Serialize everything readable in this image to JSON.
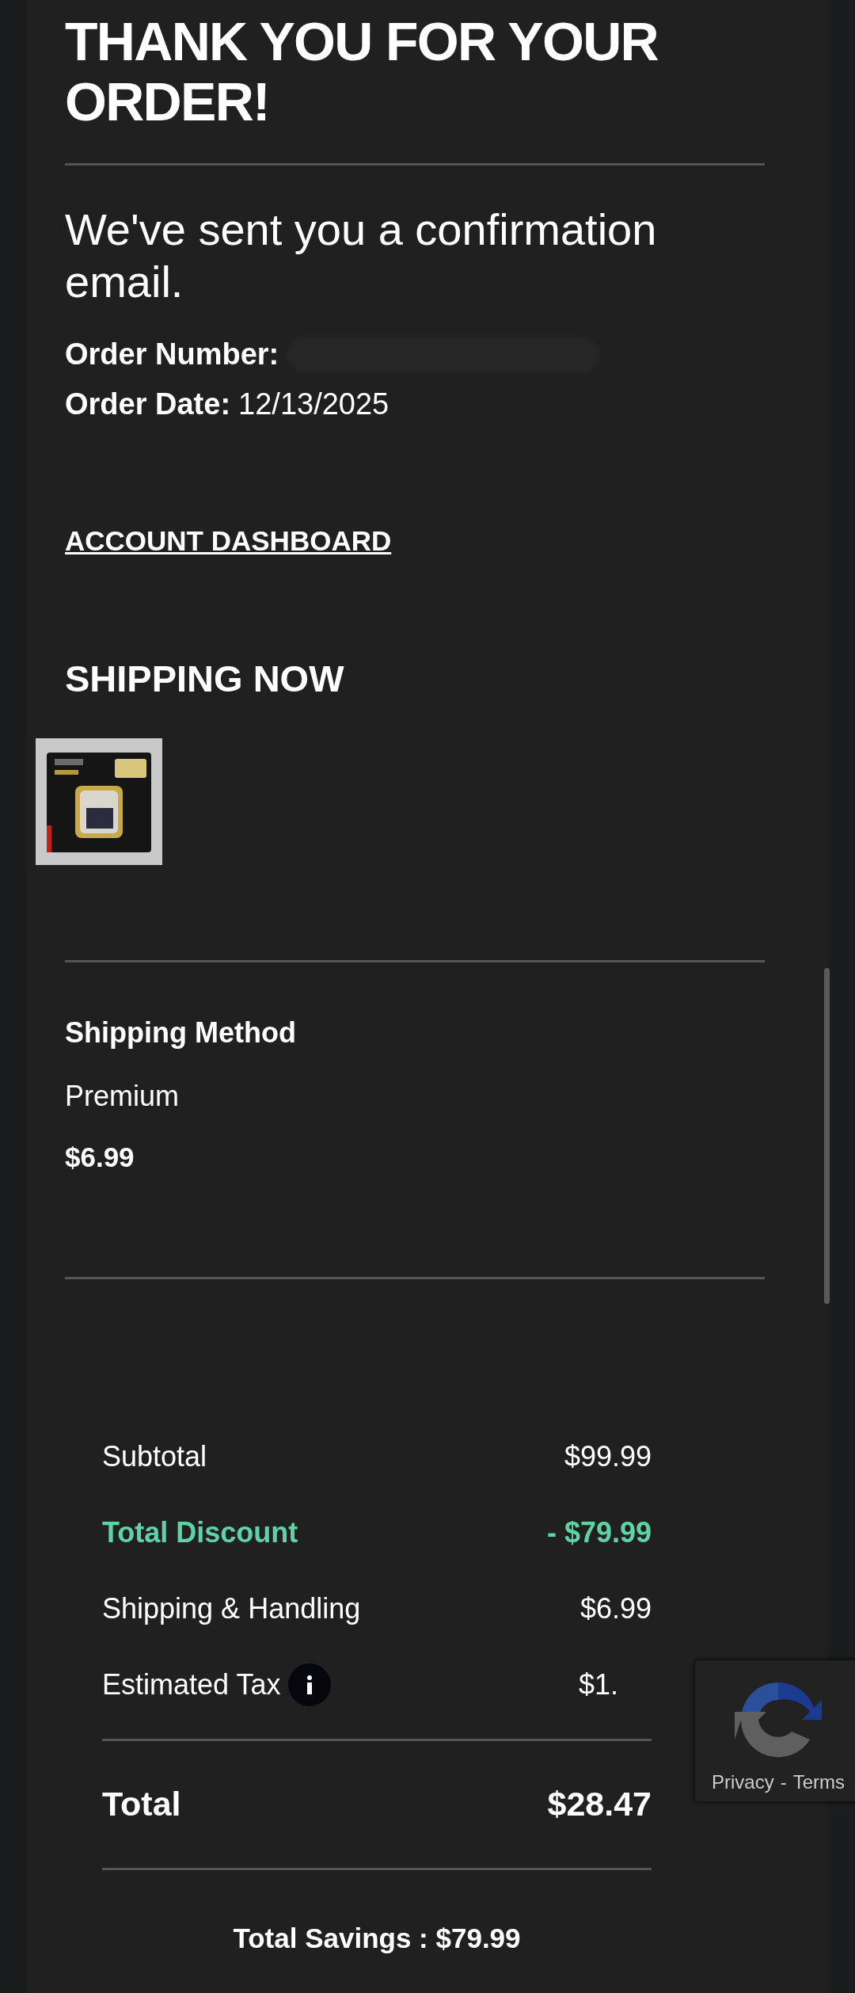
{
  "heading": "THANK YOU FOR YOUR ORDER!",
  "confirmation": "We've sent you a confirmation email.",
  "order_number": {
    "label": "Order Number:"
  },
  "order_date": {
    "label": "Order Date:",
    "value": "12/13/2025"
  },
  "account_link": "ACCOUNT DASHBOARD",
  "shipping_now": {
    "title": "SHIPPING NOW"
  },
  "shipping_method": {
    "title": "Shipping Method",
    "name": "Premium",
    "price": "$6.99"
  },
  "summary": {
    "rows": [
      {
        "label": "Subtotal",
        "value": "$99.99",
        "kind": "plain"
      },
      {
        "label": "Total Discount",
        "value": "- $79.99",
        "kind": "discount",
        "color": "#5fd3a8"
      },
      {
        "label": "Shipping & Handling",
        "value": "$6.99",
        "kind": "plain"
      },
      {
        "label": "Estimated Tax",
        "value": "$1.",
        "kind": "info"
      }
    ],
    "total": {
      "label": "Total",
      "value": "$28.47"
    },
    "savings": "Total Savings : $79.99"
  },
  "recaptcha": {
    "links": [
      "Privacy",
      "Terms"
    ],
    "separator": "-"
  }
}
